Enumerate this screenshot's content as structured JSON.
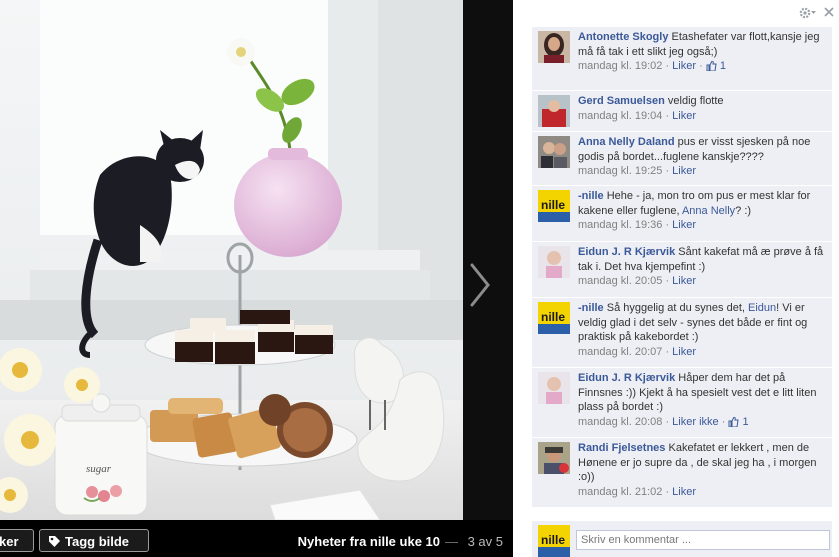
{
  "photo": {
    "album_title": "Nyheter fra nille uke 10",
    "separator": "—",
    "counter": "3 av 5",
    "like_label": "ker",
    "tag_label": "Tagg bilde"
  },
  "comments": [
    {
      "name": "Antonette Skogly",
      "parts": [
        "Etashefater var flott,kansje jeg må få tak i ett slikt jeg også;)"
      ],
      "mention": "",
      "time": "mandag kl. 19:02",
      "like_label": "Liker",
      "like_count": "1",
      "avatar": "woman-dark-hair"
    },
    {
      "name": "Gerd Samuelsen",
      "parts": [
        "veldig flotte"
      ],
      "mention": "",
      "time": "mandag kl. 19:04",
      "like_label": "Liker",
      "like_count": "",
      "avatar": "woman-red"
    },
    {
      "name": "Anna Nelly Daland",
      "parts": [
        "pus er visst sjesken på noe godis på bordet...fuglene kanskje????"
      ],
      "mention": "",
      "time": "mandag kl. 19:25",
      "like_label": "Liker",
      "like_count": "",
      "avatar": "couple"
    },
    {
      "name": "-nille",
      "parts": [
        "Hehe - ja, mon tro om pus er mest klar for kakene eller fuglene, ",
        "? :)"
      ],
      "mention": "Anna Nelly",
      "time": "mandag kl. 19:36",
      "like_label": "Liker",
      "like_count": "",
      "avatar": "nille-logo"
    },
    {
      "name": "Eidun J. R Kjærvik",
      "parts": [
        "Sånt kakefat må æ prøve å få tak i. Det hva kjempefint :)"
      ],
      "mention": "",
      "time": "mandag kl. 20:05",
      "like_label": "Liker",
      "like_count": "",
      "avatar": "person-light"
    },
    {
      "name": "-nille",
      "parts": [
        "Så hyggelig at du synes det, ",
        "! Vi er veldig glad i det selv - synes det både er fint og praktisk på kakebordet :)"
      ],
      "mention": "Eidun",
      "time": "mandag kl. 20:07",
      "like_label": "Liker",
      "like_count": "",
      "avatar": "nille-logo"
    },
    {
      "name": "Eidun J. R Kjærvik",
      "parts": [
        "Håper dem har det på Finnsnes :)) Kjekt å ha spesielt vest det e litt liten plass på bordet :)"
      ],
      "mention": "",
      "time": "mandag kl. 20:08",
      "like_label": "Liker ikke",
      "like_count": "1",
      "avatar": "person-light"
    },
    {
      "name": "Randi Fjelsetnes",
      "parts": [
        "Kakefatet er lekkert , men de Hønene er jo supre da , de skal jeg ha , i morgen :o))"
      ],
      "mention": "",
      "time": "mandag kl. 21:02",
      "like_label": "Liker",
      "like_count": "",
      "avatar": "person-cap"
    }
  ],
  "compose": {
    "placeholder": "Skriv en kommentar ...",
    "avatar": "nille-logo"
  },
  "icons": {
    "gear": "gear-icon",
    "close": "close-icon",
    "next": "chevron-right-icon",
    "tag": "tag-icon",
    "thumb": "thumbs-up-icon"
  },
  "colors": {
    "link": "#3b5998",
    "comment_bg": "#edeff4",
    "meta": "#808080",
    "nille_yellow": "#f3d300"
  }
}
